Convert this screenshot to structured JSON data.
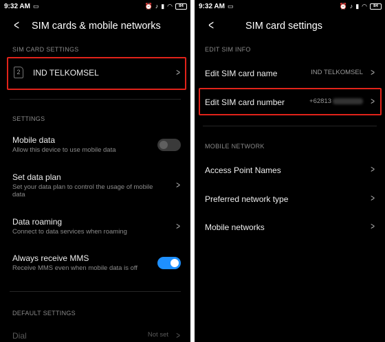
{
  "left": {
    "status": {
      "time": "9:32 AM",
      "battery": "84"
    },
    "title": "SIM cards & mobile networks",
    "sim_section": "SIM CARD SETTINGS",
    "sim": {
      "slot": "2",
      "name": "IND TELKOMSEL"
    },
    "settings_section": "SETTINGS",
    "mobile_data": {
      "label": "Mobile data",
      "sub": "Allow this device to use mobile data",
      "enabled": false
    },
    "data_plan": {
      "label": "Set data plan",
      "sub": "Set your data plan to control the usage of mobile data"
    },
    "data_roaming": {
      "label": "Data roaming",
      "sub": "Connect to data services when roaming"
    },
    "mms": {
      "label": "Always receive MMS",
      "sub": "Receive MMS even when mobile data is off",
      "enabled": true
    },
    "default_section": "DEFAULT SETTINGS",
    "dial": {
      "label": "Dial",
      "value": "Not set"
    }
  },
  "right": {
    "status": {
      "time": "9:32 AM",
      "battery": "84"
    },
    "title": "SIM card settings",
    "edit_section": "EDIT SIM INFO",
    "sim_name": {
      "label": "Edit SIM card name",
      "value": "IND TELKOMSEL"
    },
    "sim_number": {
      "label": "Edit SIM card number",
      "value": "+62813"
    },
    "network_section": "MOBILE NETWORK",
    "apn": {
      "label": "Access Point Names"
    },
    "network_type": {
      "label": "Preferred network type"
    },
    "mobile_networks": {
      "label": "Mobile networks"
    }
  },
  "colors": {
    "highlight": "#e2231a",
    "toggle_on": "#1e90ff",
    "background": "#000000"
  },
  "icons": [
    "back-arrow-icon",
    "chevron-right-icon",
    "sim-card-icon",
    "wifi-icon",
    "battery-icon",
    "alarm-icon",
    "silent-icon"
  ]
}
